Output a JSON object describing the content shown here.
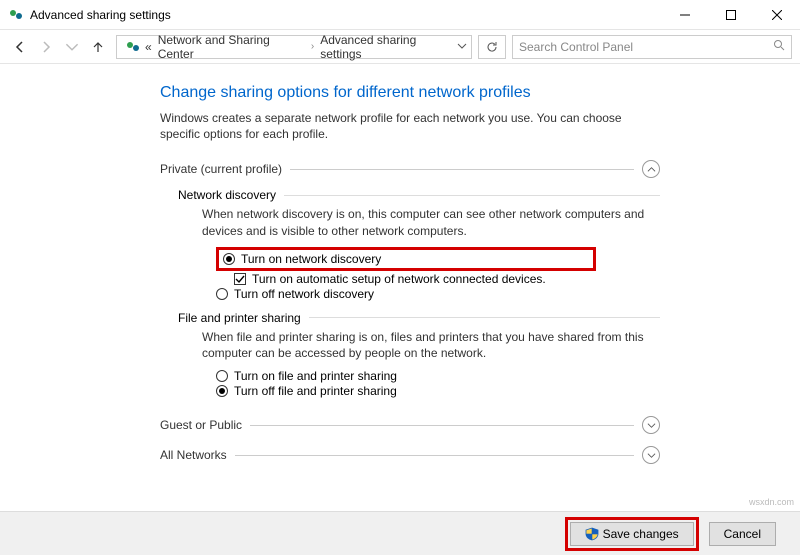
{
  "window": {
    "title": "Advanced sharing settings"
  },
  "nav": {
    "breadcrumb_prefix": "«",
    "crumb1": "Network and Sharing Center",
    "crumb2": "Advanced sharing settings",
    "search_placeholder": "Search Control Panel"
  },
  "page": {
    "title": "Change sharing options for different network profiles",
    "description": "Windows creates a separate network profile for each network you use. You can choose specific options for each profile."
  },
  "private": {
    "label": "Private (current profile)",
    "network_discovery": {
      "heading": "Network discovery",
      "description": "When network discovery is on, this computer can see other network computers and devices and is visible to other network computers.",
      "opt_on": "Turn on network discovery",
      "opt_auto": "Turn on automatic setup of network connected devices.",
      "opt_off": "Turn off network discovery",
      "selected": "on",
      "auto_checked": true
    },
    "file_printer": {
      "heading": "File and printer sharing",
      "description": "When file and printer sharing is on, files and printers that you have shared from this computer can be accessed by people on the network.",
      "opt_on": "Turn on file and printer sharing",
      "opt_off": "Turn off file and printer sharing",
      "selected": "off"
    }
  },
  "guest": {
    "label": "Guest or Public"
  },
  "all": {
    "label": "All Networks"
  },
  "buttons": {
    "save": "Save changes",
    "cancel": "Cancel"
  },
  "watermark": "wsxdn.com"
}
